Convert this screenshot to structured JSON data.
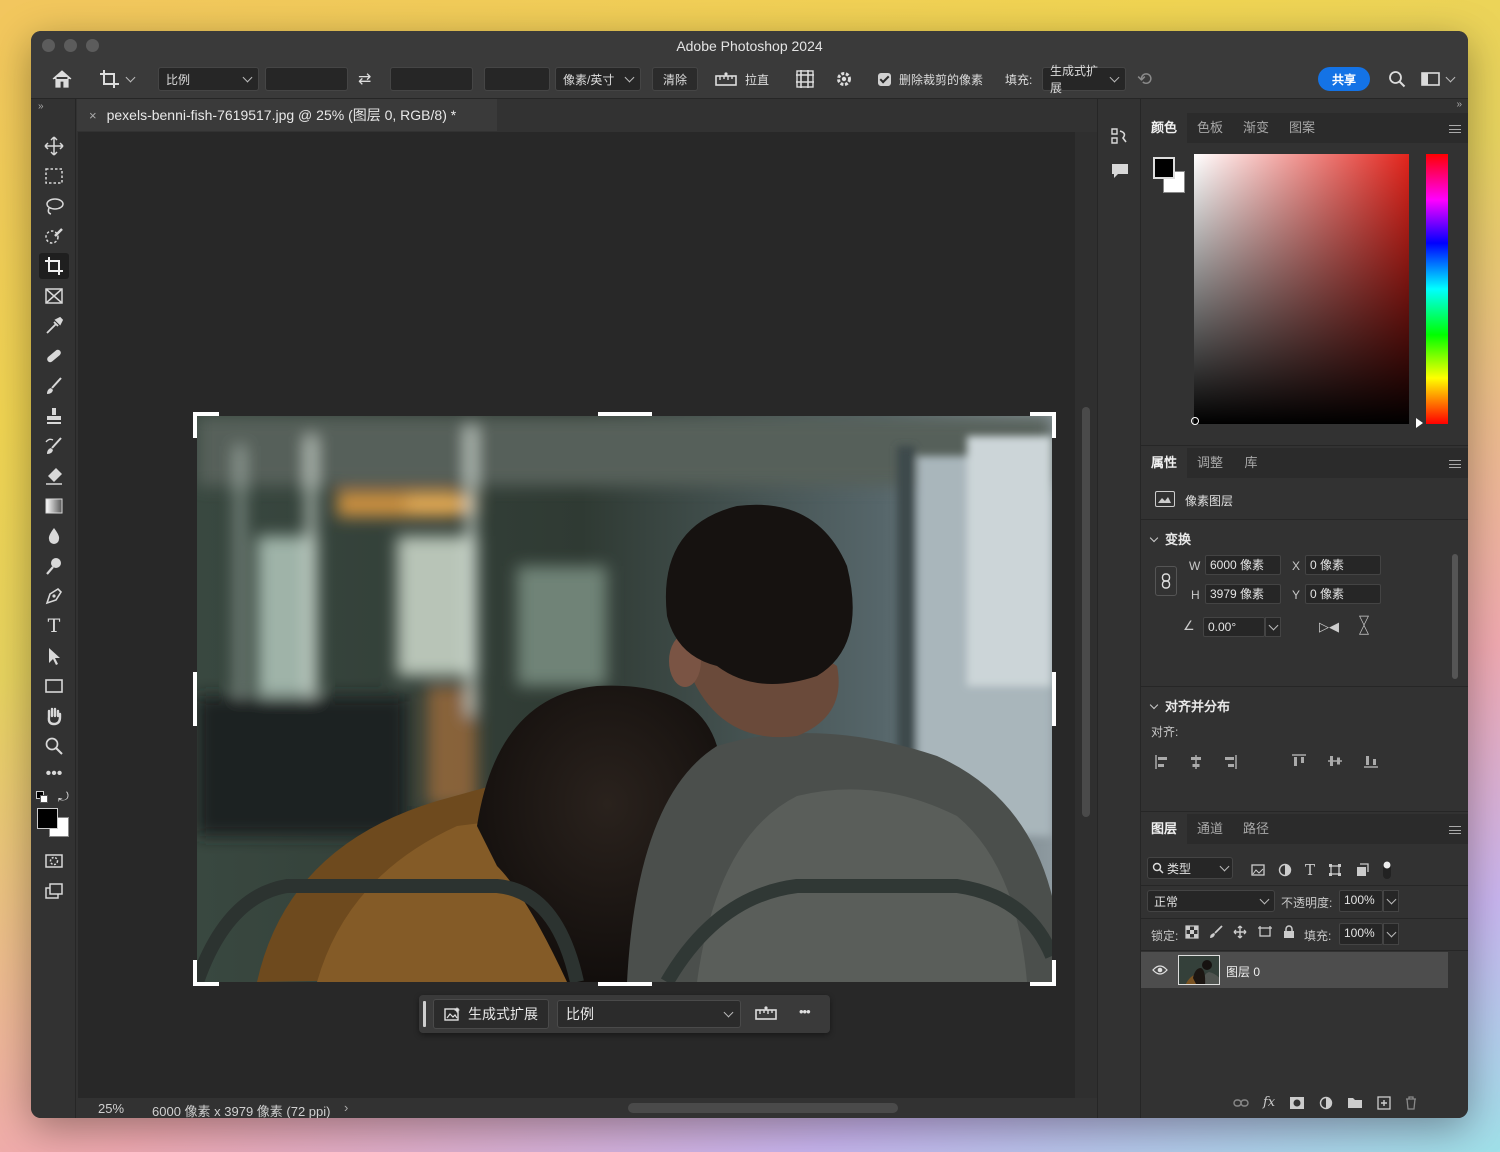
{
  "window": {
    "title": "Adobe Photoshop 2024"
  },
  "options_bar": {
    "ratio_select": "比例",
    "units_select": "像素/英寸",
    "clear_label": "清除",
    "straighten_label": "拉直",
    "delete_cropped_label": "删除裁剪的像素",
    "fill_label": "填充:",
    "fill_select": "生成式扩展",
    "share_label": "共享"
  },
  "document": {
    "tab_title": "pexels-benni-fish-7619517.jpg @ 25% (图层 0, RGB/8) *",
    "zoom": "25%",
    "info": "6000 像素 x 3979 像素 (72 ppi)"
  },
  "context_bar": {
    "generative_expand_label": "生成式扩展",
    "ratio_select": "比例",
    "more_label": "•••"
  },
  "color_panel": {
    "tabs": [
      "颜色",
      "色板",
      "渐变",
      "图案"
    ],
    "foreground": "#000000",
    "background": "#ffffff",
    "hue_color": "#e2241c"
  },
  "properties_panel": {
    "tabs": [
      "属性",
      "调整",
      "库"
    ],
    "layer_type": "像素图层",
    "transform_title": "变换",
    "w_label": "W",
    "w_value": "6000 像素",
    "h_label": "H",
    "h_value": "3979 像素",
    "x_label": "X",
    "x_value": "0 像素",
    "y_label": "Y",
    "y_value": "0 像素",
    "angle_value": "0.00°",
    "align_title": "对齐并分布",
    "align_label": "对齐:"
  },
  "layers_panel": {
    "tabs": [
      "图层",
      "通道",
      "路径"
    ],
    "filter_select": "类型",
    "blend_mode": "正常",
    "opacity_label": "不透明度:",
    "opacity_value": "100%",
    "lock_label": "锁定:",
    "fill_label": "填充:",
    "fill_value": "100%",
    "layer_name": "图层 0"
  }
}
